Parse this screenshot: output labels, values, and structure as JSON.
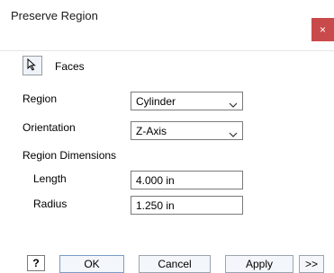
{
  "dialog": {
    "title": "Preserve Region",
    "close_label": "×"
  },
  "faces": {
    "label": "Faces",
    "icon": "cursor-arrow-icon"
  },
  "region": {
    "label": "Region",
    "value": "Cylinder"
  },
  "orientation": {
    "label": "Orientation",
    "value": "Z-Axis"
  },
  "region_dimensions": {
    "label": "Region Dimensions",
    "length": {
      "label": "Length",
      "value": "4.000 in"
    },
    "radius": {
      "label": "Radius",
      "value": "1.250 in"
    }
  },
  "footer": {
    "help_label": "?",
    "ok_label": "OK",
    "cancel_label": "Cancel",
    "apply_label": "Apply",
    "more_label": ">>"
  },
  "colors": {
    "close_bg": "#c94a4a",
    "button_border": "#7a9cc6"
  }
}
